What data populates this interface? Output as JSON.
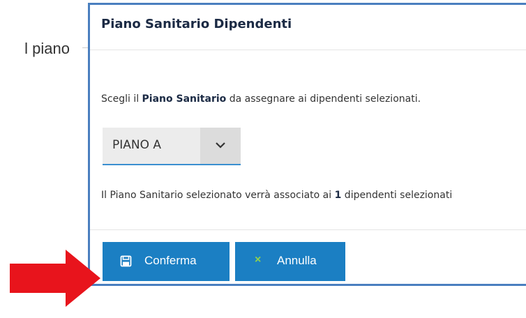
{
  "background": {
    "partial_text": "l piano"
  },
  "dialog": {
    "title": "Piano Sanitario Dipendenti",
    "instruction": {
      "prefix": "Scegli il ",
      "bold": "Piano Sanitario",
      "suffix": " da assegnare ai dipendenti selezionati."
    },
    "select": {
      "value": "PIANO A"
    },
    "info": {
      "prefix": "Il Piano Sanitario selezionato verrà associato ai ",
      "count": "1",
      "suffix": " dipendenti selezionati"
    },
    "buttons": {
      "confirm": "Conferma",
      "cancel": "Annulla"
    }
  },
  "colors": {
    "border": "#4a7fbf",
    "button": "#1b7fc3",
    "cancel_icon": "#8fd14f",
    "arrow": "#e8141c"
  },
  "icons": {
    "confirm": "save-icon",
    "cancel": "close-icon",
    "select": "chevron-down-icon",
    "pointer": "arrow-right-icon"
  }
}
